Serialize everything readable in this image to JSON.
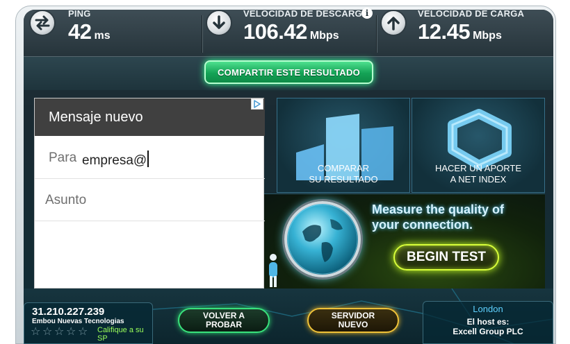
{
  "stats": {
    "ping": {
      "label": "PING",
      "value": "42",
      "unit": "ms",
      "icon": "swap-arrows-icon"
    },
    "download": {
      "label": "VELOCIDAD DE DESCARGA",
      "value": "106.42",
      "unit": "Mbps",
      "icon": "arrow-down-icon"
    },
    "upload": {
      "label": "VELOCIDAD DE CARGA",
      "value": "12.45",
      "unit": "Mbps",
      "icon": "arrow-up-icon"
    },
    "info_glyph": "i"
  },
  "share": {
    "label": "COMPARTIR ESTE RESULTADO"
  },
  "tiles": {
    "compare": {
      "line1": "COMPARAR",
      "line2": "SU RESULTADO"
    },
    "contribute": {
      "line1": "HACER UN APORTE",
      "line2": "A NET INDEX"
    }
  },
  "banner": {
    "line1": "Measure the quality of",
    "line2": "your connection.",
    "button": "BEGIN TEST"
  },
  "popup": {
    "title": "Mensaje nuevo",
    "to_label": "Para",
    "to_value": "empresa@",
    "subject_placeholder": "Asunto"
  },
  "footer": {
    "ip": "31.210.227.239",
    "isp": "Embou Nuevas Tecnologias",
    "rate_line1": "Califique a su",
    "rate_line2": "SP",
    "stars_count": 5,
    "retest": {
      "line1": "VOLVER A",
      "line2": "PROBAR"
    },
    "new_server": {
      "line1": "SERVIDOR",
      "line2": "NUEVO"
    },
    "server_city": "London",
    "host_label": "El host es:",
    "host": "Excell Group PLC"
  },
  "colors": {
    "accent_green": "#14a356",
    "accent_gold": "#f0c238",
    "accent_lime": "#d9ff3a",
    "city_blue": "#5fd2ff"
  }
}
